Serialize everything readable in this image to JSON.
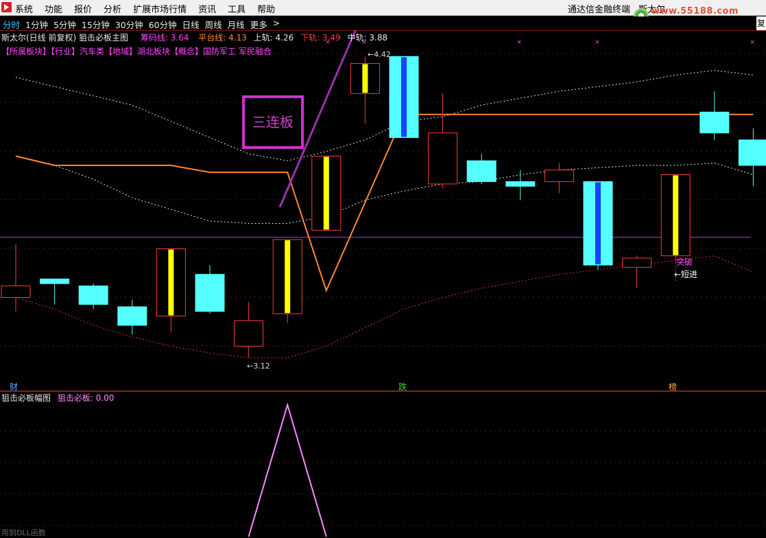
{
  "menu": {
    "items": [
      "系统",
      "功能",
      "报价",
      "分析",
      "扩展市场行情",
      "资讯",
      "工具",
      "帮助"
    ],
    "terminal_name": "通达信金融终端",
    "stock_short": "斯太尔",
    "watermark": "www.55188.com"
  },
  "period_bar": {
    "items": [
      "分时",
      "1分钟",
      "5分钟",
      "15分钟",
      "30分钟",
      "60分钟",
      "日线",
      "周线",
      "月线",
      "更多",
      ">"
    ],
    "active": "分时",
    "restore_label": "复"
  },
  "main_info": {
    "title": "斯太尔(日线 前复权) 狙击必板主图",
    "chouma_label": "筹码线:",
    "chouma_value": "3.64",
    "pingtai_label": "平台线:",
    "pingtai_value": "4.13",
    "shanggui_label": "上轨:",
    "shanggui_value": "4.26",
    "xiagui_label": "下轨:",
    "xiagui_value": "3.49",
    "zhonggui_label": "中轨:",
    "zhonggui_value": "3.88"
  },
  "sectors": "【所属板块】【行业】汽车类【地域】湖北板块【概念】国防军工 军民融合",
  "annotations": {
    "high_label": "←4.42",
    "low_label": "←3.12",
    "breakout_label": "突破",
    "short_entry_label": "←短进",
    "boxed_text": "三连板",
    "marker_cai": "财",
    "marker_die": "跌",
    "marker_bang": "榜"
  },
  "sub_info": {
    "title": "狙击必板幅图",
    "indicator_label": "狙击必板:",
    "indicator_value": "0.00"
  },
  "footer_text": "用到DLL函数",
  "colors": {
    "up_candle": "#ff3b3b",
    "down_candle": "#55ffff",
    "limit_up_bar": "#ffff00",
    "platform_line": "#ff8833",
    "chouma_line": "#cc33cc",
    "band_line": "#ffffff",
    "lower_band": "#dd3322",
    "sub_line": "#ff88ff"
  },
  "chart_data": {
    "type": "candlestick",
    "period": "日线",
    "candles": [
      {
        "o": 3.38,
        "c": 3.43,
        "h": 3.61,
        "l": 3.32
      },
      {
        "o": 3.46,
        "c": 3.44,
        "h": 3.46,
        "l": 3.35
      },
      {
        "o": 3.43,
        "c": 3.35,
        "h": 3.44,
        "l": 3.33
      },
      {
        "o": 3.34,
        "c": 3.26,
        "h": 3.37,
        "l": 3.22
      },
      {
        "o": 3.3,
        "c": 3.59,
        "h": 3.59,
        "l": 3.23,
        "limit_up": true
      },
      {
        "o": 3.48,
        "c": 3.32,
        "h": 3.52,
        "l": 3.31
      },
      {
        "o": 3.17,
        "c": 3.28,
        "h": 3.36,
        "l": 3.12
      },
      {
        "o": 3.31,
        "c": 3.63,
        "h": 3.63,
        "l": 3.27,
        "limit_up": true
      },
      {
        "o": 3.67,
        "c": 3.99,
        "h": 3.99,
        "l": 3.67,
        "limit_up": true
      },
      {
        "o": 4.26,
        "c": 4.39,
        "h": 4.42,
        "l": 4.13,
        "limit_up": true
      },
      {
        "o": 4.42,
        "c": 4.07,
        "h": 4.42,
        "l": 4.07,
        "limit_down": true
      },
      {
        "o": 3.87,
        "c": 4.09,
        "h": 4.26,
        "l": 3.85
      },
      {
        "o": 3.97,
        "c": 3.88,
        "h": 4.0,
        "l": 3.87
      },
      {
        "o": 3.88,
        "c": 3.86,
        "h": 3.93,
        "l": 3.8
      },
      {
        "o": 3.88,
        "c": 3.93,
        "h": 3.96,
        "l": 3.83
      },
      {
        "o": 3.88,
        "c": 3.52,
        "h": 3.88,
        "l": 3.5,
        "limit_down": true
      },
      {
        "o": 3.51,
        "c": 3.55,
        "h": 3.56,
        "l": 3.42
      },
      {
        "o": 3.56,
        "c": 3.91,
        "h": 3.91,
        "l": 3.54,
        "limit_up": true
      },
      {
        "o": 4.18,
        "c": 4.09,
        "h": 4.27,
        "l": 4.06
      },
      {
        "o": 4.06,
        "c": 3.95,
        "h": 4.11,
        "l": 3.86
      }
    ],
    "platform_line": [
      3.99,
      3.95,
      3.95,
      3.95,
      3.95,
      3.92,
      3.92,
      3.92,
      3.41,
      null,
      4.17,
      4.17,
      4.17,
      4.17,
      4.17,
      4.17,
      4.17,
      4.17,
      4.17,
      4.17
    ],
    "upper_band": [
      4.33,
      4.29,
      4.25,
      4.21,
      4.14,
      4.07,
      4.0,
      3.97,
      4.01,
      4.06,
      4.14,
      4.16,
      4.21,
      4.24,
      4.27,
      4.29,
      4.31,
      4.34,
      4.36,
      4.34
    ],
    "middle_band": [
      3.99,
      3.95,
      3.89,
      3.81,
      3.76,
      3.71,
      3.7,
      3.7,
      3.73,
      3.8,
      3.84,
      3.87,
      3.88,
      3.91,
      3.93,
      3.94,
      3.95,
      3.95,
      3.96,
      3.91
    ],
    "lower_band": [
      3.38,
      3.33,
      3.26,
      3.21,
      3.17,
      3.14,
      3.12,
      3.12,
      3.17,
      3.25,
      3.33,
      3.38,
      3.42,
      3.45,
      3.48,
      3.5,
      3.52,
      3.54,
      3.56,
      3.49
    ],
    "chouma_line": 3.64,
    "ylim": [
      3.05,
      4.48
    ],
    "sub_series": [
      0,
      0,
      0,
      0,
      0,
      0,
      0,
      1,
      0,
      0,
      0,
      0,
      0,
      0,
      0,
      0,
      0,
      0,
      0,
      0
    ]
  }
}
